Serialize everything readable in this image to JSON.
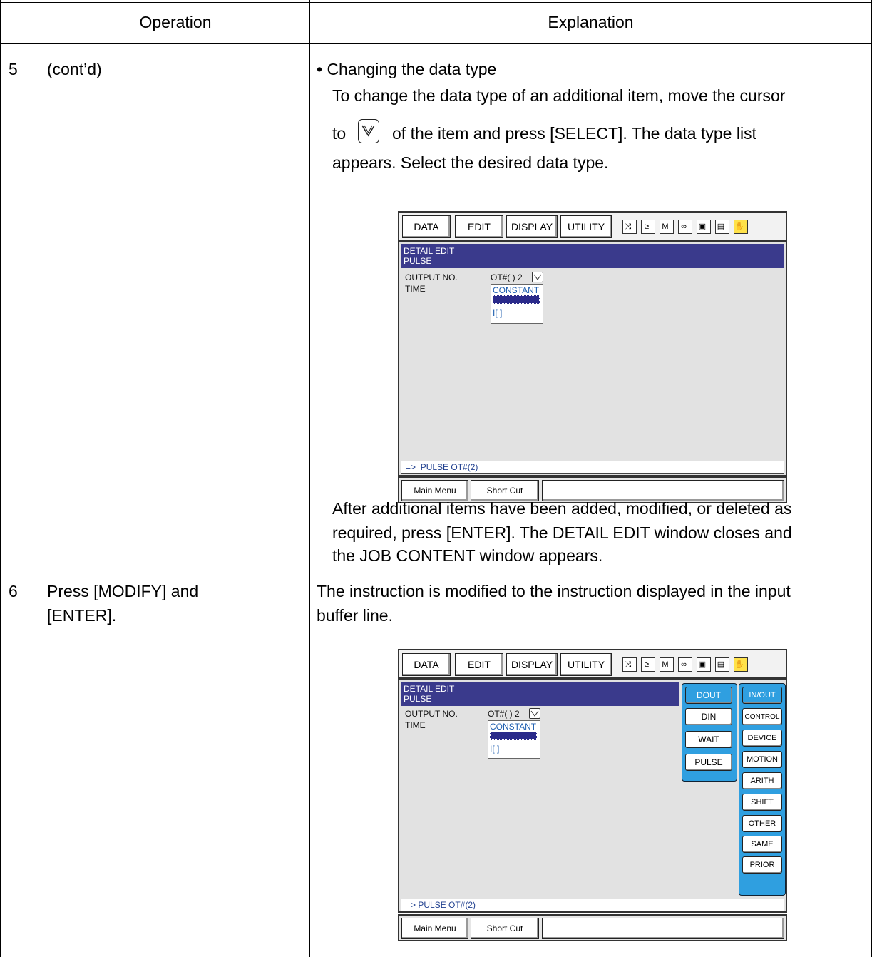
{
  "header": {
    "operation": "Operation",
    "explanation": "Explanation"
  },
  "row5": {
    "step": "5",
    "operation": "(cont’d)",
    "bullet": "• Changing the data type",
    "para1_a": "To change the data type of an additional item, move the cursor",
    "para1_b_pre": "to",
    "para1_b_post": "of the item and press [SELECT]. The data type list",
    "para1_c": "appears. Select the desired data type.",
    "para2_a": "After additional items have been added, modified, or deleted as",
    "para2_b": "required, press [ENTER]. The DETAIL EDIT window closes and",
    "para2_c": "the JOB CONTENT window appears."
  },
  "row6": {
    "step": "6",
    "operation_a": "Press [MODIFY] and",
    "operation_b": "[ENTER].",
    "expl_a": "The instruction is modified to the instruction displayed in the input",
    "expl_b": "buffer line."
  },
  "screen": {
    "menu": [
      "DATA",
      "EDIT",
      "DISPLAY",
      "UTILITY"
    ],
    "title1": "DETAIL EDIT",
    "title2": "PULSE",
    "output_label": "OUTPUT NO.",
    "output_value": "OT#( ) 2",
    "time_label": "TIME",
    "dropdown": [
      "CONSTANT",
      "I[ ]"
    ],
    "buffer_arrow": "=>",
    "buffer_text": "PULSE OT#(2)",
    "bottom": [
      "Main Menu",
      "Short Cut"
    ],
    "instr": [
      "DOUT",
      "DIN",
      "WAIT",
      "PULSE"
    ],
    "categories": [
      "IN/OUT",
      "CONTROL",
      "DEVICE",
      "MOTION",
      "ARITH",
      "SHIFT",
      "OTHER",
      "SAME",
      "PRIOR"
    ]
  }
}
